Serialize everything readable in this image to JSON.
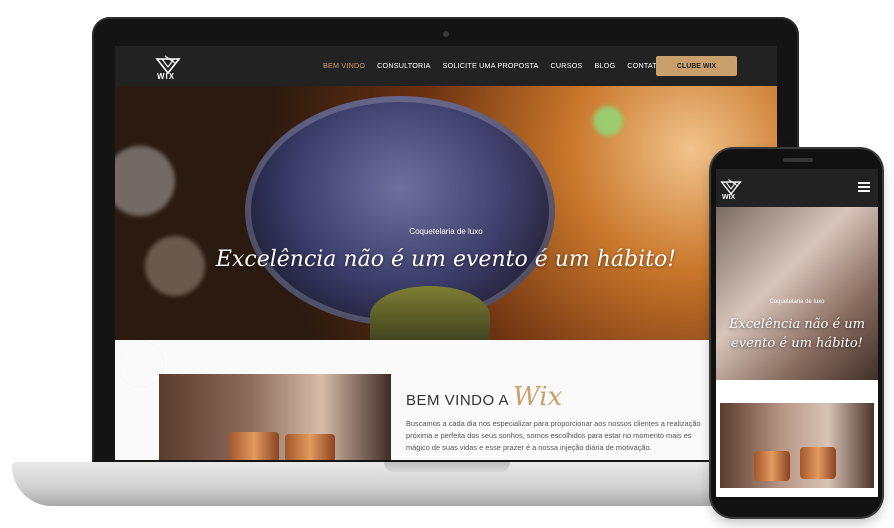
{
  "laptop": {
    "logo_text": "WIX",
    "nav": {
      "items": [
        "BEM VINDO",
        "CONSULTORIA",
        "SOLICITE UMA PROPOSTA",
        "CURSOS",
        "BLOG",
        "CONTATO"
      ],
      "active_index": 0,
      "cta_label": "CLUBE WIX"
    },
    "hero": {
      "subtitle": "Coquetelaria de luxo",
      "title": "Excelência não é um evento é um hábito!"
    },
    "welcome": {
      "lead": "BEM VINDO A",
      "script": "Wix",
      "paragraph_lines": [
        "Buscamos a cada dia nos especializar para proporcionar aos nossos clientes a realização",
        "próxima e perfeita dos seus sonhos, somos escolhidos para estar no momento mais es",
        "mágico de suas vidas e esse prazer é a nossa injeção diária de motivação."
      ]
    }
  },
  "phone": {
    "logo_text": "WIX",
    "hero": {
      "subtitle": "Coquetelaria de luxo",
      "title": "Excelência não é um evento é um hábito!"
    }
  },
  "colors": {
    "accent": "#c9a06b",
    "nav_bg": "#222222"
  },
  "icons": [
    "wix-logo-icon",
    "hamburger-menu-icon"
  ]
}
